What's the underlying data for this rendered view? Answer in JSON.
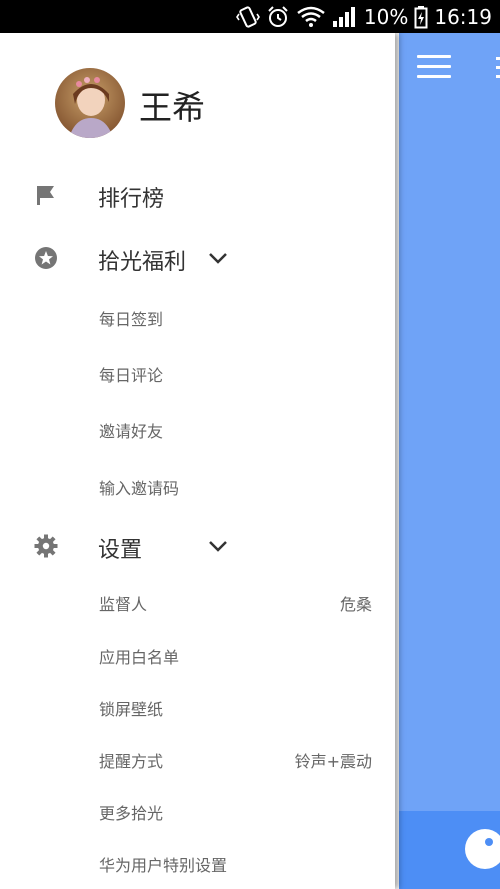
{
  "status_bar": {
    "battery": "10%",
    "time": "16:19"
  },
  "profile": {
    "name": "王希"
  },
  "menu": {
    "ranking": {
      "label": "排行榜",
      "icon": "flag-icon"
    },
    "welfare": {
      "label": "拾光福利",
      "icon": "star-icon",
      "items": [
        {
          "label": "每日签到"
        },
        {
          "label": "每日评论"
        },
        {
          "label": "邀请好友"
        },
        {
          "label": "输入邀请码"
        }
      ]
    },
    "settings": {
      "label": "设置",
      "icon": "gear-icon",
      "items": [
        {
          "label": "监督人",
          "value": "危桑"
        },
        {
          "label": "应用白名单",
          "value": ""
        },
        {
          "label": "锁屏壁纸",
          "value": ""
        },
        {
          "label": "提醒方式",
          "value": "铃声+震动"
        },
        {
          "label": "更多拾光",
          "value": ""
        },
        {
          "label": "华为用户特别设置",
          "value": ""
        }
      ]
    }
  },
  "colors": {
    "main_bg": "#6fa3f7",
    "main_bottom": "#4d8ef5",
    "icon_gray": "#757575"
  }
}
